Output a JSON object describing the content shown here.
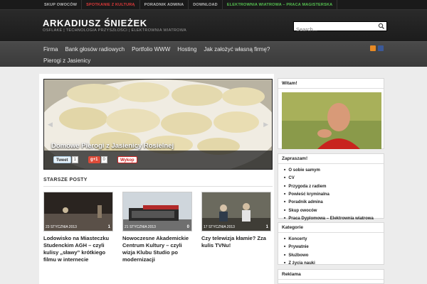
{
  "topnav": [
    "SKUP OWOCÓW",
    "SPOTKANIE Z KULTURĄ",
    "PORADNIK ADMINA",
    "DOWNLOAD",
    "ELEKTROWNIA WIATROWA – PRACA MAGISTERSKA"
  ],
  "header": {
    "title": "ARKADIUSZ ŚNIEŻEK",
    "description": "OSFLAKE | TECHNOLOGIA PRZYSZŁOŚCI | ELEKTROWNIA WIATROWA",
    "search_placeholder": "Search..."
  },
  "mainnav": {
    "row1": [
      "Firma",
      "Bank głosów radiowych",
      "Portfolio WWW",
      "Hosting",
      "Jak założyć własną firmę?"
    ],
    "row2": [
      "Pierogi z Jasienicy"
    ]
  },
  "slider": {
    "title": "Domowe Pierogi z Jasienicy Rosielnej",
    "tweet_label": "Tweet",
    "tweet_count": "1",
    "gplus_label": "g+1",
    "gplus_count": "0",
    "wykop_label": "Wykop"
  },
  "older_posts": {
    "heading": "STARSZE POSTY",
    "posts": [
      {
        "date": "23 STYCZNIA 2013",
        "comments": "1",
        "title": "Lodowisko na Miasteczku Studenckim AGH – czyli kulisy „sławy” krótkiego filmu w internecie"
      },
      {
        "date": "21 STYCZNIA 2013",
        "comments": "0",
        "title": "Nowoczesne Akademickie Centrum Kultury – czyli wizja Klubu Studio po modernizacji"
      },
      {
        "date": "17 STYCZNIA 2013",
        "comments": "1",
        "title": "Czy telewizja kłamie? Zza kulis TVNu!"
      }
    ]
  },
  "sidebar": {
    "welcome_title": "Witam!",
    "zapraszam_title": "Zapraszam!",
    "zapraszam_items": [
      "O sobie samym",
      "CV",
      "Przygoda z radiem",
      "Powieść kryminalna",
      "Poradnik admina",
      "Skup owoców",
      "Praca Dyplomowa – Elektrownia wiatrowa"
    ],
    "categories_title": "Kategorie",
    "categories": [
      "Koncerty",
      "Prywatnie",
      "Służbowo",
      "Z życia nauki"
    ],
    "ads_title": "Reklama"
  },
  "colors": {
    "accent_red": "#e03a3a",
    "accent_green": "#56c151",
    "rss": "#e88a24",
    "facebook": "#3b5998"
  }
}
